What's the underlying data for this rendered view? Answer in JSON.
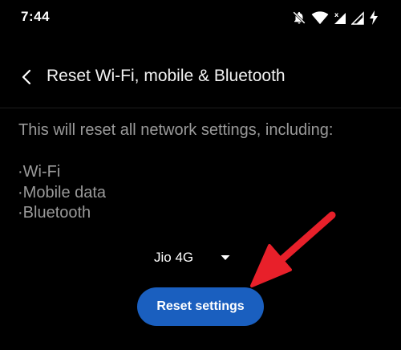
{
  "status_bar": {
    "time": "7:44",
    "icons": [
      "notifications-off-icon",
      "wifi-icon",
      "cell-signal-icon",
      "cell-signal-icon",
      "charging-icon"
    ]
  },
  "app_bar": {
    "back_icon": "chevron-left-icon",
    "title": "Reset Wi-Fi, mobile & Bluetooth"
  },
  "content": {
    "description": "This will reset all network settings, including:",
    "items": [
      "·Wi-Fi",
      "·Mobile data",
      "·Bluetooth"
    ]
  },
  "sim_selector": {
    "selected": "Jio 4G",
    "caret_icon": "dropdown-caret-icon"
  },
  "actions": {
    "reset_label": "Reset settings"
  },
  "colors": {
    "background": "#000000",
    "primary_button": "#1a5fbf",
    "secondary_text": "#9a9a9a",
    "annotation_arrow": "#e8202a"
  }
}
